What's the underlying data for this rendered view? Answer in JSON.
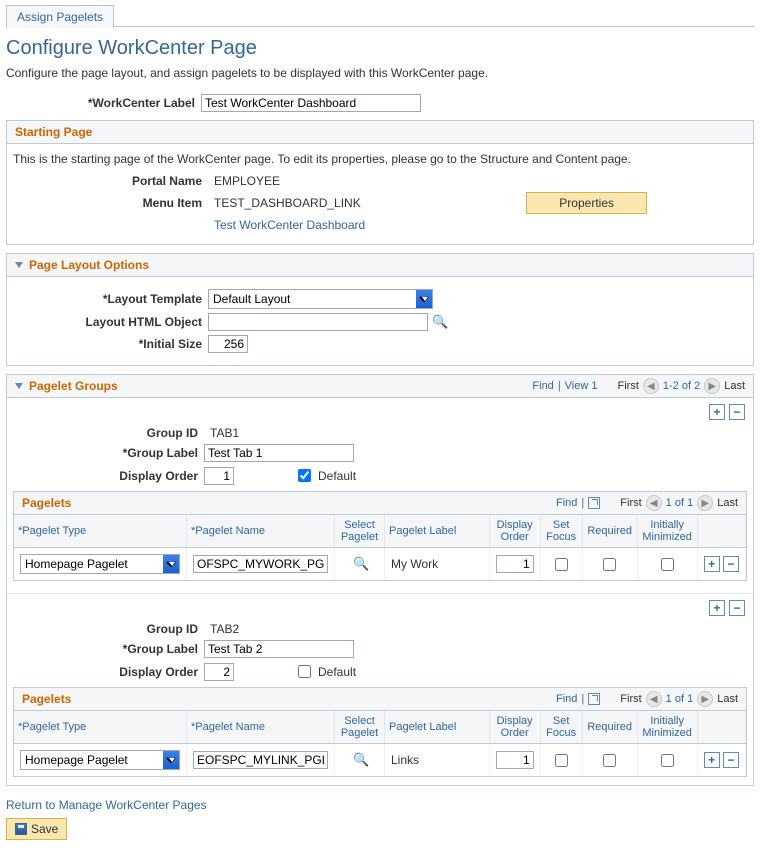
{
  "tab_label": "Assign Pagelets",
  "page_title": "Configure WorkCenter Page",
  "instructions": "Configure the page layout, and assign pagelets to be displayed with this WorkCenter page.",
  "workcenter_label_label": "*WorkCenter Label",
  "workcenter_label_value": "Test WorkCenter Dashboard",
  "starting_page": {
    "title": "Starting Page",
    "text": "This is the starting page of the WorkCenter page. To edit its properties, please go to the Structure and Content page.",
    "portal_name_label": "Portal Name",
    "portal_name_value": "EMPLOYEE",
    "menu_item_label": "Menu Item",
    "menu_item_value": "TEST_DASHBOARD_LINK",
    "properties_btn": "Properties",
    "link_text": "Test WorkCenter Dashboard"
  },
  "page_layout": {
    "title": "Page Layout Options",
    "layout_template_label": "*Layout Template",
    "layout_template_value": "Default Layout",
    "layout_html_label": "Layout HTML Object",
    "layout_html_value": "",
    "initial_size_label": "*Initial Size",
    "initial_size_value": "256"
  },
  "pagelet_groups": {
    "title": "Pagelet Groups",
    "find": "Find",
    "view_all": "View 1",
    "first": "First",
    "last": "Last",
    "range": "1-2 of 2",
    "group_id_label": "Group ID",
    "group_label_label": "*Group Label",
    "display_order_label": "Display Order",
    "default_label": "Default",
    "pagelets_title": "Pagelets",
    "pagelets_range": "1 of 1",
    "cols": {
      "pagelet_type": "*Pagelet Type",
      "pagelet_name": "*Pagelet Name",
      "select_pagelet": "Select Pagelet",
      "pagelet_label": "Pagelet Label",
      "display_order": "Display Order",
      "set_focus": "Set Focus",
      "required": "Required",
      "initially_minimized": "Initially Minimized"
    },
    "groups": [
      {
        "id": "TAB1",
        "label": "Test Tab 1",
        "order": "1",
        "is_default": true,
        "pagelets": [
          {
            "type": "Homepage Pagelet",
            "name": "OFSPC_MYWORK_PGLT",
            "label": "My Work",
            "order": "1"
          }
        ]
      },
      {
        "id": "TAB2",
        "label": "Test Tab 2",
        "order": "2",
        "is_default": false,
        "pagelets": [
          {
            "type": "Homepage Pagelet",
            "name": "EOFSPC_MYLINK_PGLT",
            "label": "Links",
            "order": "1"
          }
        ]
      }
    ]
  },
  "return_link": "Return to Manage WorkCenter Pages",
  "save_btn": "Save"
}
